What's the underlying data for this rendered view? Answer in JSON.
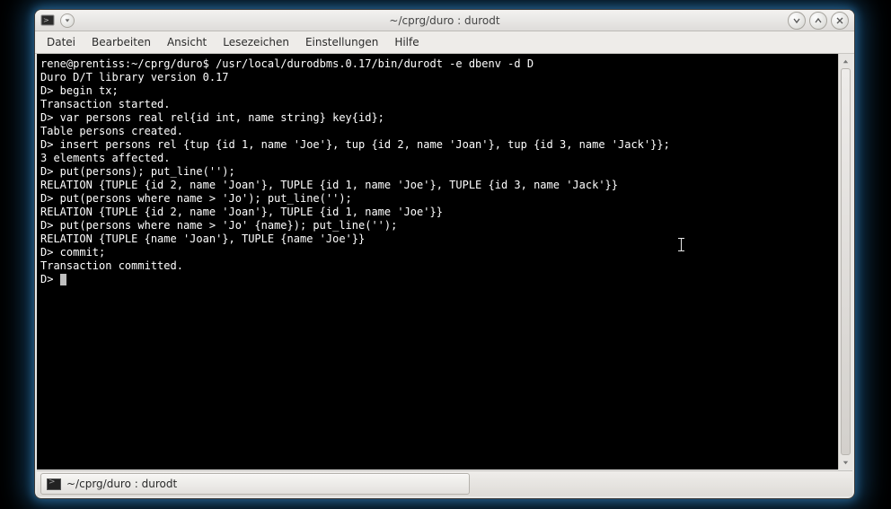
{
  "window": {
    "title": "~/cprg/duro : durodt"
  },
  "menu": {
    "items": [
      "Datei",
      "Bearbeiten",
      "Ansicht",
      "Lesezeichen",
      "Einstellungen",
      "Hilfe"
    ]
  },
  "terminal": {
    "promptUserHost": "rene@prentiss:",
    "promptPath": "~/cprg/duro$ ",
    "initialCmd": "/usr/local/durodbms.0.17/bin/durodt -e dbenv -d D",
    "lines": [
      "Duro D/T library version 0.17",
      "D> begin tx;",
      "Transaction started.",
      "D> var persons real rel{id int, name string} key{id};",
      "Table persons created.",
      "D> insert persons rel {tup {id 1, name 'Joe'}, tup {id 2, name 'Joan'}, tup {id 3, name 'Jack'}};",
      "3 elements affected.",
      "D> put(persons); put_line('');",
      "RELATION {TUPLE {id 2, name 'Joan'}, TUPLE {id 1, name 'Joe'}, TUPLE {id 3, name 'Jack'}}",
      "D> put(persons where name > 'Jo'); put_line('');",
      "RELATION {TUPLE {id 2, name 'Joan'}, TUPLE {id 1, name 'Joe'}}",
      "D> put(persons where name > 'Jo' {name}); put_line('');",
      "RELATION {TUPLE {name 'Joan'}, TUPLE {name 'Joe'}}",
      "D> commit;",
      "Transaction committed.",
      "D> "
    ]
  },
  "taskbar": {
    "label": "~/cprg/duro : durodt"
  },
  "icons": {
    "terminal": "terminal-icon",
    "dropdown": "chevron-down-icon",
    "minimize": "minimize-icon",
    "maximize": "maximize-icon",
    "close": "close-icon",
    "scrollUp": "chevron-up-icon",
    "scrollDown": "chevron-down-icon"
  }
}
